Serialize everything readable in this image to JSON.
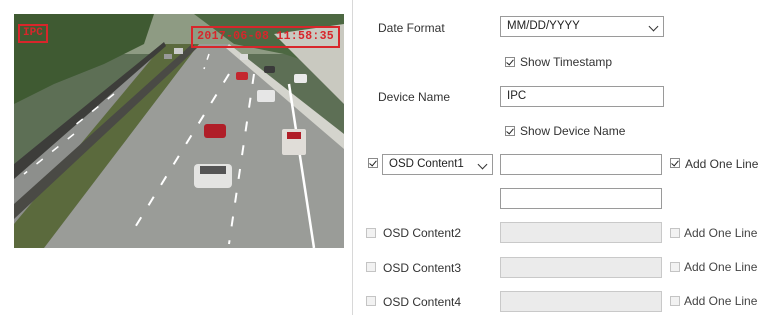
{
  "preview": {
    "osd_name": "IPC",
    "osd_timestamp": "2017-06-08 11:58:35"
  },
  "settings": {
    "date_format": {
      "label": "Date Format",
      "value": "MM/DD/YYYY"
    },
    "show_timestamp": {
      "label": "Show Timestamp",
      "checked": true
    },
    "device_name": {
      "label": "Device Name",
      "value": "IPC"
    },
    "show_device_name": {
      "label": "Show Device Name",
      "checked": true
    },
    "osd_rows": [
      {
        "label": "OSD Content1",
        "checked": true,
        "is_select": true,
        "value": "",
        "add_label": "Add One Line",
        "add_checked": true,
        "enabled": true
      },
      {
        "label": "OSD Content2",
        "checked": false,
        "is_select": false,
        "value": "",
        "add_label": "Add One Line",
        "add_checked": false,
        "enabled": false
      },
      {
        "label": "OSD Content3",
        "checked": false,
        "is_select": false,
        "value": "",
        "add_label": "Add One Line",
        "add_checked": false,
        "enabled": false
      },
      {
        "label": "OSD Content4",
        "checked": false,
        "is_select": false,
        "value": "",
        "add_label": "Add One Line",
        "add_checked": false,
        "enabled": false
      }
    ]
  },
  "colors": {
    "osd_red": "#d8262b",
    "disabled_field": "#ebebeb",
    "border": "#9a9a9a"
  }
}
